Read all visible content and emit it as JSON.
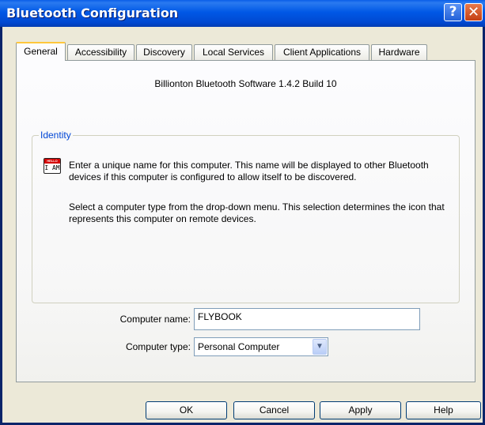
{
  "window": {
    "title": "Bluetooth Configuration",
    "help_glyph": "?",
    "close_glyph": "✕"
  },
  "tabs": [
    {
      "label": "General",
      "active": true
    },
    {
      "label": "Accessibility",
      "active": false
    },
    {
      "label": "Discovery",
      "active": false
    },
    {
      "label": "Local Services",
      "active": false
    },
    {
      "label": "Client Applications",
      "active": false
    },
    {
      "label": "Hardware",
      "active": false
    }
  ],
  "general": {
    "version_text": "Billionton Bluetooth Software 1.4.2 Build 10",
    "identity": {
      "group_label": "Identity",
      "icon": {
        "name": "hello-i-am-icon",
        "top_text": "HELLO",
        "bottom_text": "I AM"
      },
      "description_1": "Enter a unique name for this computer.  This name will be displayed to other Bluetooth devices if this computer is configured to allow itself to be discovered.",
      "description_2": "Select a computer type from the drop-down menu.  This selection determines the icon that represents this computer on remote devices.",
      "computer_name_label": "Computer name:",
      "computer_name_value": "FLYBOOK",
      "computer_type_label": "Computer type:",
      "computer_type_value": "Personal Computer"
    }
  },
  "buttons": {
    "ok": "OK",
    "cancel": "Cancel",
    "apply": "Apply",
    "help": "Help"
  },
  "colors": {
    "titlebar": "#0058e6",
    "window_bg": "#ece9d8",
    "group_label": "#0046d5",
    "active_tab_accent": "#ffc73c"
  }
}
